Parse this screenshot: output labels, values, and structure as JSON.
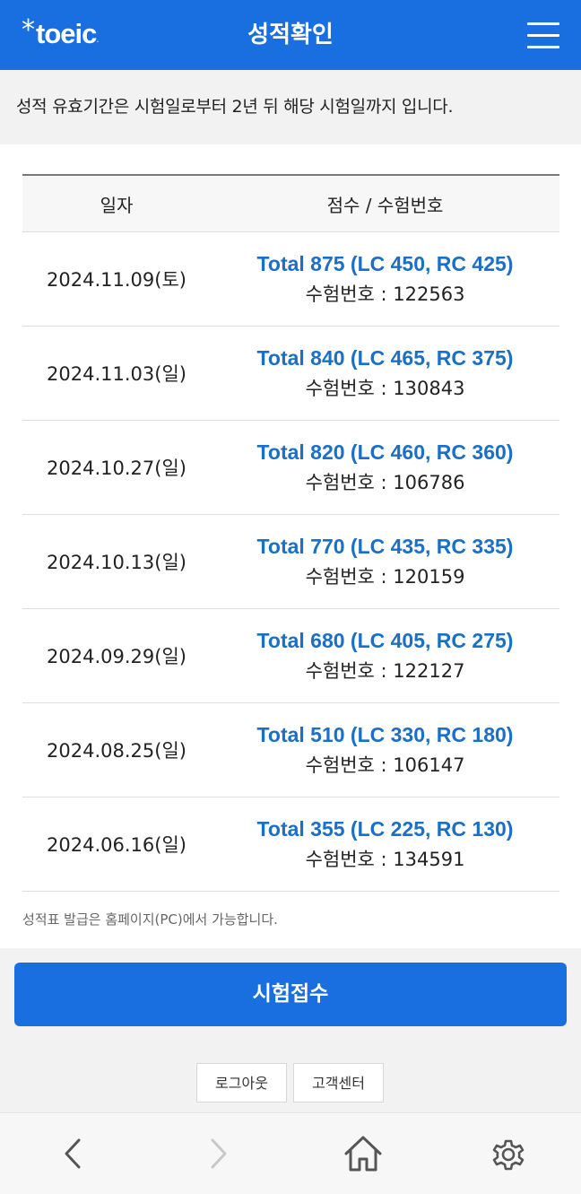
{
  "header": {
    "logo_star": "*",
    "logo_text": "toeic",
    "logo_dot": ".",
    "title": "성적확인",
    "menu_icon": "hamburger-menu-icon"
  },
  "notice": "성적 유효기간은 시험일로부터 2년 뒤 해당 시험일까지 입니다.",
  "table": {
    "col_date": "일자",
    "col_score": "점수 / 수험번호",
    "rows": [
      {
        "date": "2024.11.09(토)",
        "score": "Total 875 (LC 450, RC 425)",
        "exam_no": "수험번호 : 122563"
      },
      {
        "date": "2024.11.03(일)",
        "score": "Total 840 (LC 465, RC 375)",
        "exam_no": "수험번호 : 130843"
      },
      {
        "date": "2024.10.27(일)",
        "score": "Total 820 (LC 460, RC 360)",
        "exam_no": "수험번호 : 106786"
      },
      {
        "date": "2024.10.13(일)",
        "score": "Total 770 (LC 435, RC 335)",
        "exam_no": "수험번호 : 120159"
      },
      {
        "date": "2024.09.29(일)",
        "score": "Total 680 (LC 405, RC 275)",
        "exam_no": "수험번호 : 122127"
      },
      {
        "date": "2024.08.25(일)",
        "score": "Total 510 (LC 330, RC 180)",
        "exam_no": "수험번호 : 106147"
      },
      {
        "date": "2024.06.16(일)",
        "score": "Total 355 (LC 225, RC 130)",
        "exam_no": "수험번호 : 134591"
      }
    ]
  },
  "footnote": "성적표 발급은 홈페이지(PC)에서 가능합니다.",
  "apply_button": "시험접수",
  "logout_button": "로그아웃",
  "support_button": "고객센터",
  "nav": {
    "back_icon": "chevron-left-icon",
    "forward_icon": "chevron-right-icon",
    "home_icon": "home-icon",
    "settings_icon": "gear-icon"
  },
  "colors": {
    "brand_blue": "#1a6fe0",
    "score_blue": "#1a6fc7",
    "background_gray": "#f2f2f2"
  }
}
